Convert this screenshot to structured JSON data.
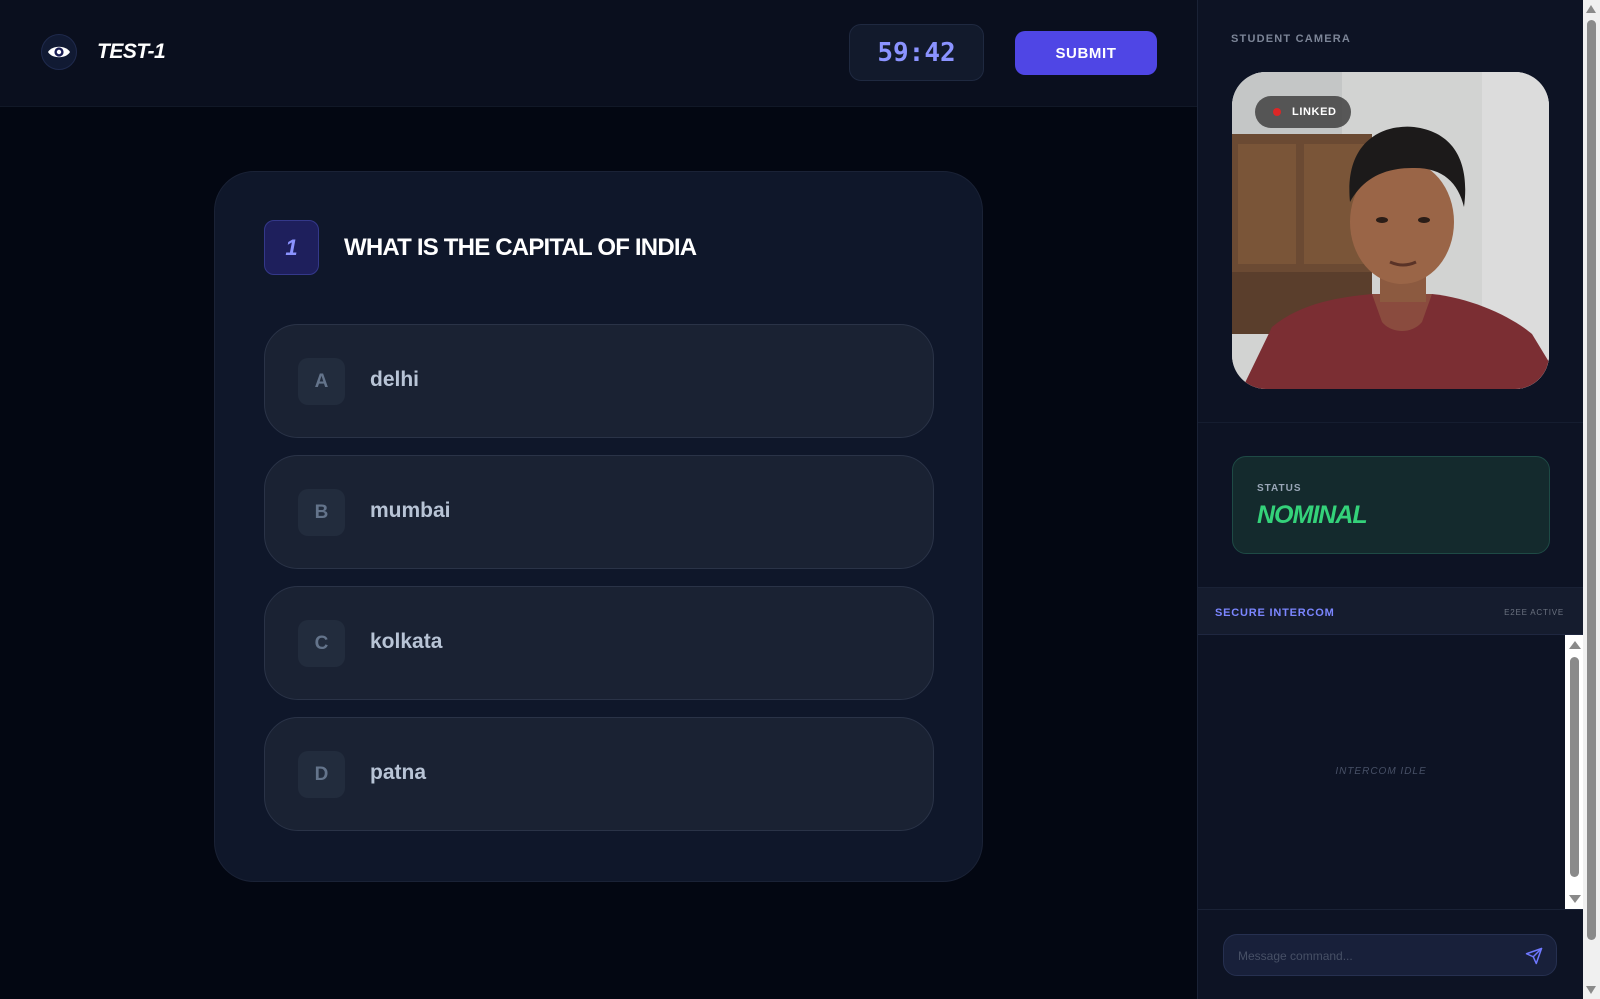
{
  "header": {
    "app_title": "TEST-1",
    "timer": "59:42",
    "submit_label": "SUBMIT",
    "logo_icon": "eye-icon"
  },
  "question": {
    "number": "1",
    "text": "WHAT IS THE CAPITAL OF INDIA",
    "options": [
      {
        "letter": "A",
        "text": "delhi"
      },
      {
        "letter": "B",
        "text": "mumbai"
      },
      {
        "letter": "C",
        "text": "kolkata"
      },
      {
        "letter": "D",
        "text": "patna"
      }
    ]
  },
  "camera": {
    "label": "STUDENT CAMERA",
    "badge": "LINKED"
  },
  "status": {
    "label": "STATUS",
    "value": "NOMINAL"
  },
  "intercom": {
    "title": "SECURE INTERCOM",
    "badge": "E2EE ACTIVE",
    "idle_text": "INTERCOM IDLE",
    "input_placeholder": "Message command...",
    "send_icon": "send-icon"
  },
  "colors": {
    "accent": "#4f46e5",
    "accent_light": "#8b93ff",
    "status_green": "#34d27a",
    "background": "#030712",
    "panel": "#0f172a"
  }
}
